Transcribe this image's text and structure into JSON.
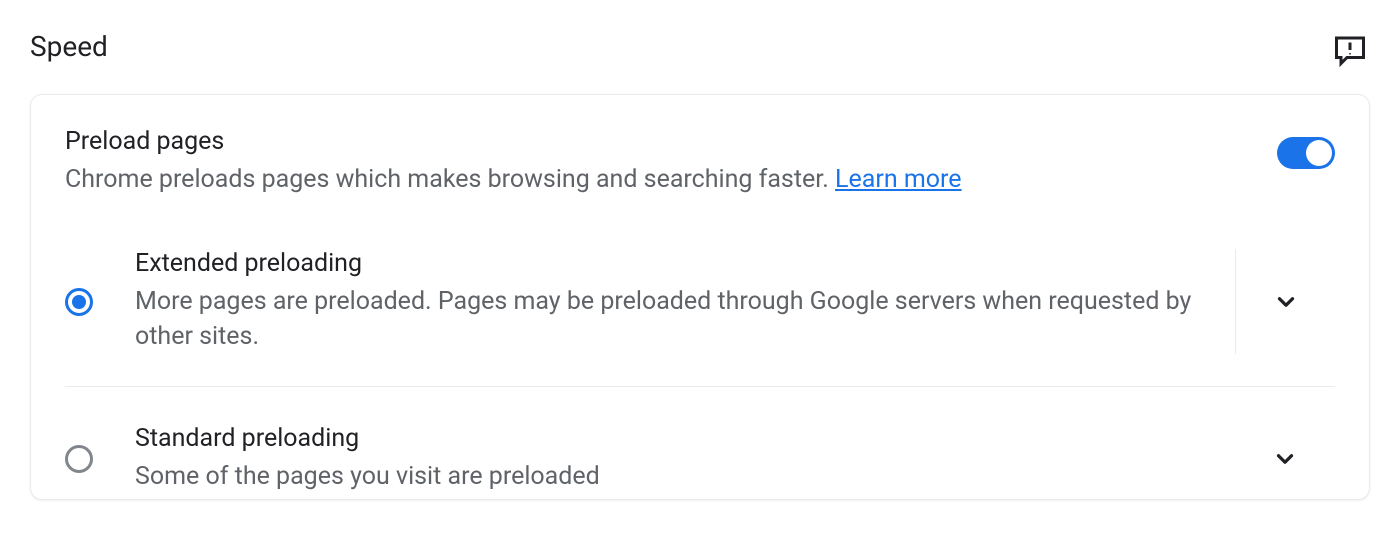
{
  "section": {
    "title": "Speed"
  },
  "card": {
    "title": "Preload pages",
    "description": "Chrome preloads pages which makes browsing and searching faster. ",
    "learn_more": "Learn more",
    "toggle_on": true
  },
  "options": [
    {
      "title": "Extended preloading",
      "description": "More pages are preloaded. Pages may be preloaded through Google servers when requested by other sites.",
      "selected": true
    },
    {
      "title": "Standard preloading",
      "description": "Some of the pages you visit are preloaded",
      "selected": false
    }
  ]
}
